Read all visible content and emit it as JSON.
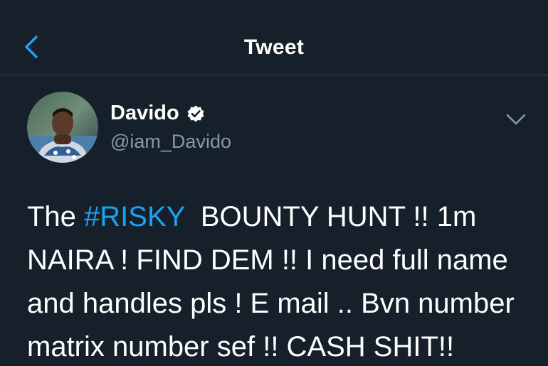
{
  "header": {
    "back_icon": "chevron-left-icon",
    "title": "Tweet",
    "accent_color": "#1da1f2"
  },
  "author": {
    "display_name": "Davido",
    "verified_icon": "verified-badge-icon",
    "handle": "@iam_Davido",
    "menu_icon": "chevron-down-icon"
  },
  "tweet": {
    "line1_prefix": "The ",
    "hashtag": "#RISKY",
    "line1_suffix": "  BOUNTY HUNT !! 1m",
    "line2": "NAIRA ! FIND DEM !! I need full name",
    "line3": "and handles pls ! E mail .. Bvn number",
    "line4": "matrix number sef !! CASH SHIT!!"
  },
  "colors": {
    "background": "#15202b",
    "divider": "#38444d",
    "secondary_text": "#8899a6",
    "link": "#1da1f2"
  }
}
